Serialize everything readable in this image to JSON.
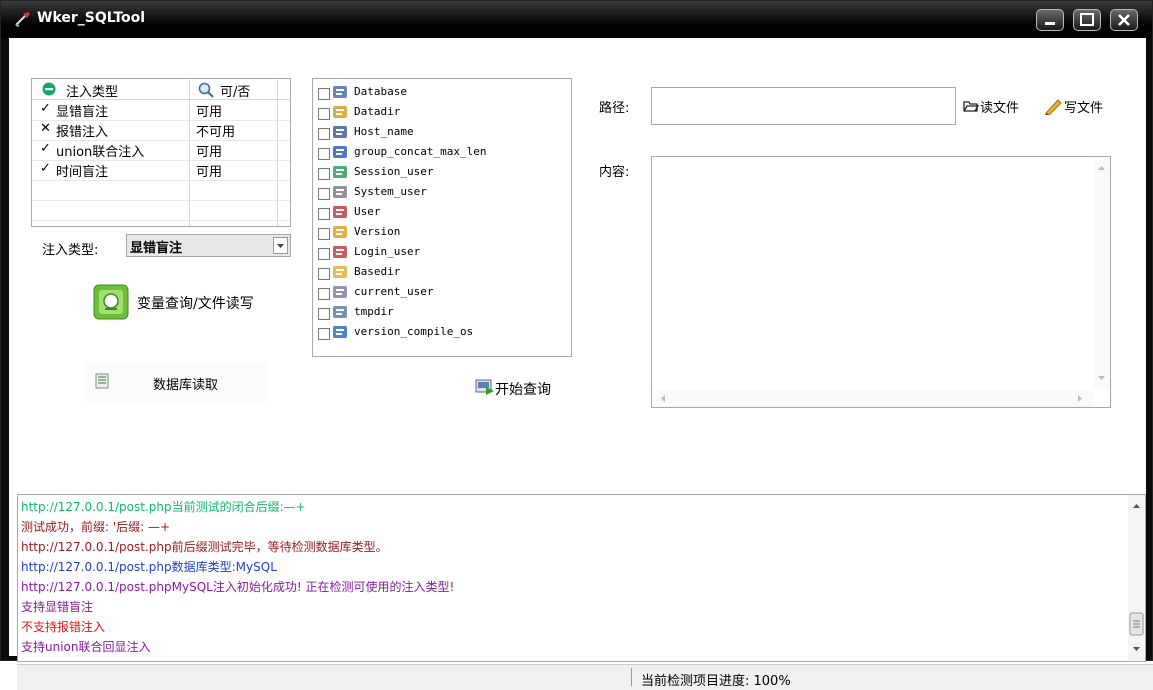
{
  "window": {
    "title": "Wker_SQLTool"
  },
  "injection_list": {
    "col_type": "注入类型",
    "col_avail": "可/否",
    "rows": [
      {
        "mark": "✓",
        "type": "显错盲注",
        "avail": "可用"
      },
      {
        "mark": "✕",
        "type": "报错注入",
        "avail": "不可用"
      },
      {
        "mark": "✓",
        "type": "union联合注入",
        "avail": "可用"
      },
      {
        "mark": "✓",
        "type": "时间盲注",
        "avail": "可用"
      }
    ]
  },
  "injection_type": {
    "label": "注入类型:",
    "value": "显错盲注"
  },
  "buttons": {
    "var_query": "变量查询/文件读写",
    "db_read": "数据库读取",
    "start_query": "开始查询",
    "read_file": "读文件",
    "write_file": "写文件"
  },
  "checkbox_items": [
    {
      "label": "Database",
      "icon": "database-icon"
    },
    {
      "label": "Datadir",
      "icon": "folder-icon"
    },
    {
      "label": "Host_name",
      "icon": "computer-icon"
    },
    {
      "label": "group_concat_max_len",
      "icon": "pencil-icon"
    },
    {
      "label": "Session_user",
      "icon": "user-session-icon"
    },
    {
      "label": "System_user",
      "icon": "system-user-icon"
    },
    {
      "label": "User",
      "icon": "users-icon"
    },
    {
      "label": "Version",
      "icon": "version-icon"
    },
    {
      "label": "Login_user",
      "icon": "login-user-icon"
    },
    {
      "label": "Basedir",
      "icon": "folder-open-icon"
    },
    {
      "label": "current_user",
      "icon": "user-card-icon"
    },
    {
      "label": "tmpdir",
      "icon": "tmp-file-icon"
    },
    {
      "label": "version_compile_os",
      "icon": "os-icon"
    }
  ],
  "file_panel": {
    "path_label": "路径:",
    "path_value": "",
    "content_label": "内容:"
  },
  "log": {
    "lines": [
      {
        "text": "http://127.0.0.1/post.php当前测试的闭合后缀:—+",
        "color": "#12b86a"
      },
      {
        "text": "测试成功，前缀: '后缀: —+",
        "color": "#9a1a1a"
      },
      {
        "text": "http://127.0.0.1/post.php前后缀测试完毕，等待检测数据库类型。",
        "color": "#9a1a1a"
      },
      {
        "text": "http://127.0.0.1/post.php数据库类型:MySQL",
        "color": "#1f3fc8"
      },
      {
        "text": "http://127.0.0.1/post.phpMySQL注入初始化成功! 正在检测可使用的注入类型!",
        "color": "#8a1aa0"
      },
      {
        "text": "支持显错盲注",
        "color": "#8a1aa0"
      },
      {
        "text": "不支持报错注入",
        "color": "#e01818"
      },
      {
        "text": "支持union联合回显注入",
        "color": "#8a1aa0"
      }
    ]
  },
  "status": {
    "progress_text": "当前检测项目进度: 100%"
  }
}
